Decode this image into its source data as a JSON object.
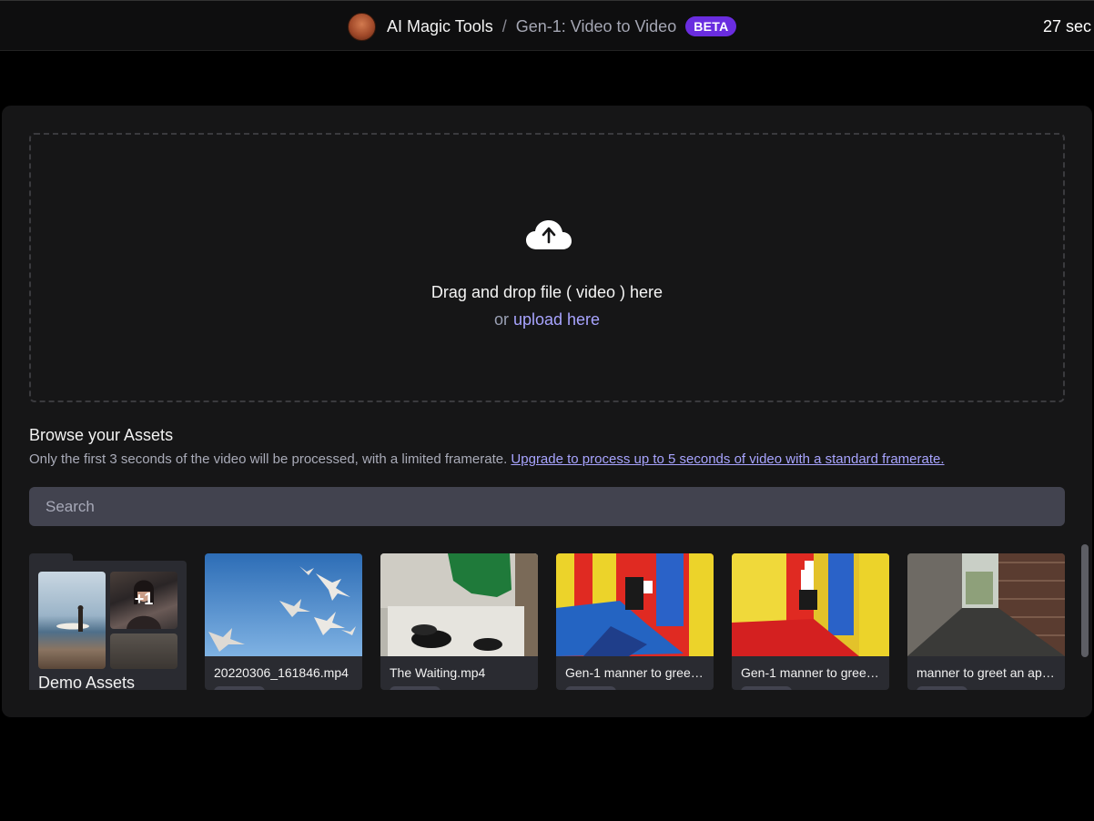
{
  "header": {
    "app_name": "AI Magic Tools",
    "separator": "/",
    "tool_name": "Gen-1: Video to Video",
    "badge": "BETA",
    "credits_text": "27 sec"
  },
  "dropzone": {
    "icon": "cloud-upload-icon",
    "primary_text": "Drag and drop file ( video ) here",
    "or_text": "or",
    "upload_link": "upload here"
  },
  "assets": {
    "title": "Browse your Assets",
    "note": "Only the first 3 seconds of the video will be processed, with a limited framerate.",
    "upgrade_link": "Upgrade to process up to 5 seconds of video with a standard framerate.",
    "search_placeholder": "Search",
    "folder": {
      "name": "Demo Assets",
      "extra_count": "+1"
    },
    "items": [
      {
        "title": "20220306_161846.mp4"
      },
      {
        "title": "The Waiting.mp4"
      },
      {
        "title": "Gen-1 manner to greet ..."
      },
      {
        "title": "Gen-1 manner to greet ..."
      },
      {
        "title": "manner to greet an appl..."
      }
    ]
  },
  "colors": {
    "accent_link": "#a8a4ff",
    "badge": "#6a2de0",
    "panel": "#161617",
    "search_bg": "#42434f"
  }
}
